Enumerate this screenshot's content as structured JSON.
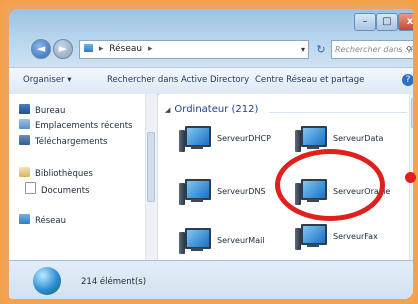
{
  "window": {
    "min": "–",
    "max": "□",
    "close": "x"
  },
  "address": {
    "segment": "Réseau",
    "sep1": "▸",
    "sep2": "▸",
    "dropdown": "▾"
  },
  "search": {
    "placeholder": "Rechercher dans : Réseau",
    "icon": "search-icon"
  },
  "toolbar": {
    "organize": "Organiser ▾",
    "search_ad": "Rechercher dans Active Directory",
    "network_center": "Centre Réseau et partage",
    "help": "?"
  },
  "sidebar": {
    "items": [
      {
        "label": "Bureau",
        "icon": "desktop-icon"
      },
      {
        "label": "Emplacements récents",
        "icon": "recent-places-icon"
      },
      {
        "label": "Téléchargements",
        "icon": "downloads-icon"
      },
      {
        "label": "Bibliothèques",
        "icon": "libraries-icon"
      },
      {
        "label": "Documents",
        "icon": "documents-icon"
      },
      {
        "label": "Réseau",
        "icon": "network-icon"
      }
    ]
  },
  "group": {
    "title": "Ordinateur (212)",
    "toggle": "◢"
  },
  "computers": [
    {
      "name": "ServeurDHCP"
    },
    {
      "name": "ServeurData"
    },
    {
      "name": "ServeurDNS"
    },
    {
      "name": "ServeurOracle"
    },
    {
      "name": "ServeurMail"
    },
    {
      "name": "ServeurFax"
    }
  ],
  "status": {
    "count": "214 élément(s)"
  },
  "colors": {
    "accent": "#2f68b4",
    "highlight": "#e0201c",
    "frame": "#f5a24c"
  }
}
